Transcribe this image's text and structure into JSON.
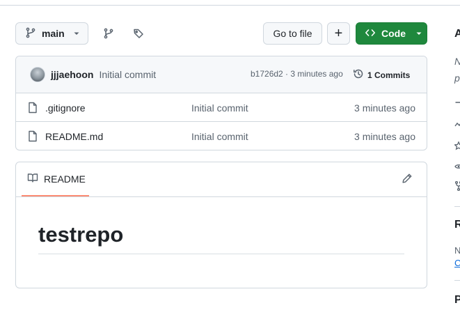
{
  "toolbar": {
    "branch_label": "main",
    "goto_file_label": "Go to file",
    "add_label": "+",
    "code_label": "Code"
  },
  "commit": {
    "author": "jjjaehoon",
    "message": "Initial commit",
    "meta": "b1726d2 · 3 minutes ago",
    "history_label": "1 Commits"
  },
  "files": [
    {
      "name": ".gitignore",
      "message": "Initial commit",
      "age": "3 minutes ago"
    },
    {
      "name": "README.md",
      "message": "Initial commit",
      "age": "3 minutes ago"
    }
  ],
  "readme": {
    "tab_label": "README",
    "title": "testrepo"
  },
  "sidebar": {
    "about_initial": "A",
    "desc_initial_1": "N",
    "desc_initial_2": "p",
    "releases_initial": "R",
    "releases_text_initial": "N",
    "releases_link_initial": "C",
    "packages_initial": "P"
  },
  "colors": {
    "accent_green": "#1f883d",
    "tab_underline": "#fd8c73",
    "border": "#d0d7de"
  }
}
